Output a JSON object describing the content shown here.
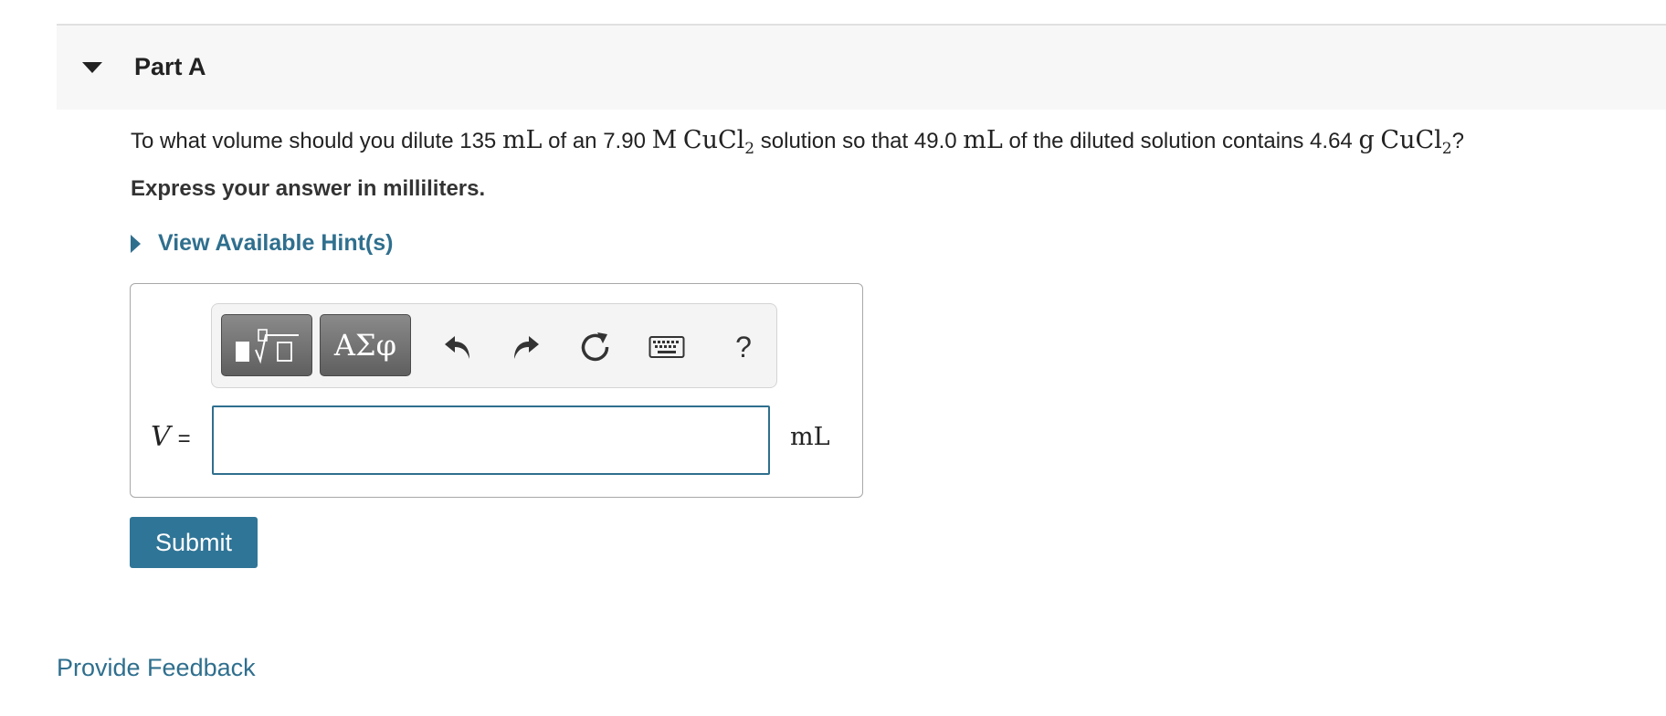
{
  "part": {
    "title": "Part A"
  },
  "question": {
    "lead": "To what volume should you dilute ",
    "volume1": "135",
    "unit1": "mL",
    "of_an": " of an ",
    "molarity": "7.90",
    "molar_unit": "M",
    "compound1": "CuCl",
    "subscript1": "2",
    "mid": " solution so that ",
    "volume2": "49.0",
    "unit2": "mL",
    "mid2": " of the diluted solution contains ",
    "mass": "4.64",
    "mass_unit": "g",
    "compound2": "CuCl",
    "subscript2": "2",
    "end": "?"
  },
  "instruction": "Express your answer in milliliters.",
  "hint": {
    "label": "View Available Hint(s)"
  },
  "toolbar": {
    "greek_label": "ΑΣφ",
    "help_label": "?",
    "icons": [
      "templates-icon",
      "undo-icon",
      "redo-icon",
      "reset-icon",
      "keyboard-icon"
    ]
  },
  "answer": {
    "variable": "V",
    "equals": "=",
    "value": "",
    "placeholder": "",
    "unit": "mL"
  },
  "submit_label": "Submit",
  "feedback_label": "Provide Feedback",
  "colors": {
    "link": "#2f6f8e",
    "submit_bg": "#2f7597",
    "header_bg": "#f7f7f7",
    "input_border": "#2f6f8e"
  }
}
